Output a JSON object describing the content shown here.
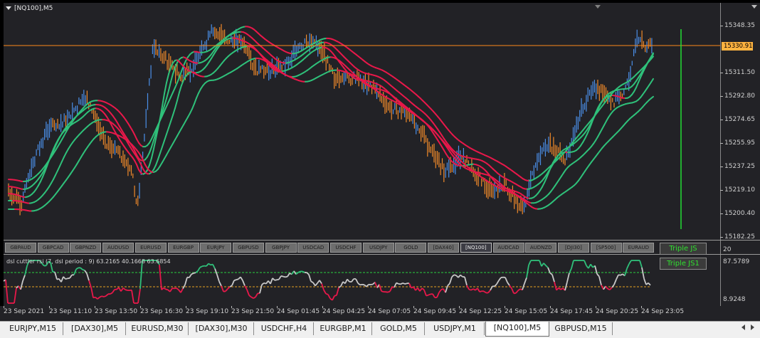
{
  "chart": {
    "title": "[NQ100],M5",
    "price_labels": [
      "15348.35",
      "15330.91",
      "15311.50",
      "15292.80",
      "15274.65",
      "15255.95",
      "15237.25",
      "15219.10",
      "15200.40",
      "15182.25"
    ],
    "current_price": "15330.91",
    "ind_axis_labels": [
      "20",
      "87.5789",
      "8.9248"
    ],
    "indicator_title": "dsl cuttler rsi (7, dsl period : 9) 63.2165 40.1668 63.6854",
    "time_labels": [
      "23 Sep 2021",
      "23 Sep 11:10",
      "23 Sep 13:50",
      "23 Sep 16:30",
      "23 Sep 19:10",
      "23 Sep 21:50",
      "24 Sep 01:45",
      "24 Sep 04:25",
      "24 Sep 07:05",
      "24 Sep 09:45",
      "24 Sep 12:25",
      "24 Sep 15:05",
      "24 Sep 17:45",
      "24 Sep 20:25",
      "24 Sep 23:05"
    ],
    "colors": {
      "bull": "#4a8fe8",
      "bear": "#f08a2a",
      "up_band": "#2fc07a",
      "down_band": "#e8184a",
      "level_line": "#ff8a1a",
      "grey_line": "#c8c8c8",
      "green_dash": "#2bd040",
      "orange_dash": "#e6a020"
    }
  },
  "symbol_buttons": [
    "GBPAUD",
    "GBPCAD",
    "GBPNZD",
    "AUDUSD",
    "EURUSD",
    "EURGBP",
    "EURJPY",
    "GBPUSD",
    "GBPJPY",
    "USDCAD",
    "USDCHF",
    "USDJPY",
    "GOLD",
    "[DAX40]",
    "[NQ100]",
    "AUDCAD",
    "AUDNZD",
    "[DJI30]",
    "[SP500]",
    "EURAUD"
  ],
  "active_symbol": "[NQ100]",
  "triple_buttons": [
    "Triple JS",
    "Triple JS1"
  ],
  "tabs": [
    "EURJPY,M15",
    "[DAX30],M5",
    "EURUSD,M30",
    "[DAX30],M30",
    "USDCHF,H4",
    "EURGBP,M1",
    "GOLD,M5",
    "USDJPY,M1",
    "[NQ100],M5",
    "GBPUSD,M15"
  ],
  "active_tab": "[NQ100],M5"
}
